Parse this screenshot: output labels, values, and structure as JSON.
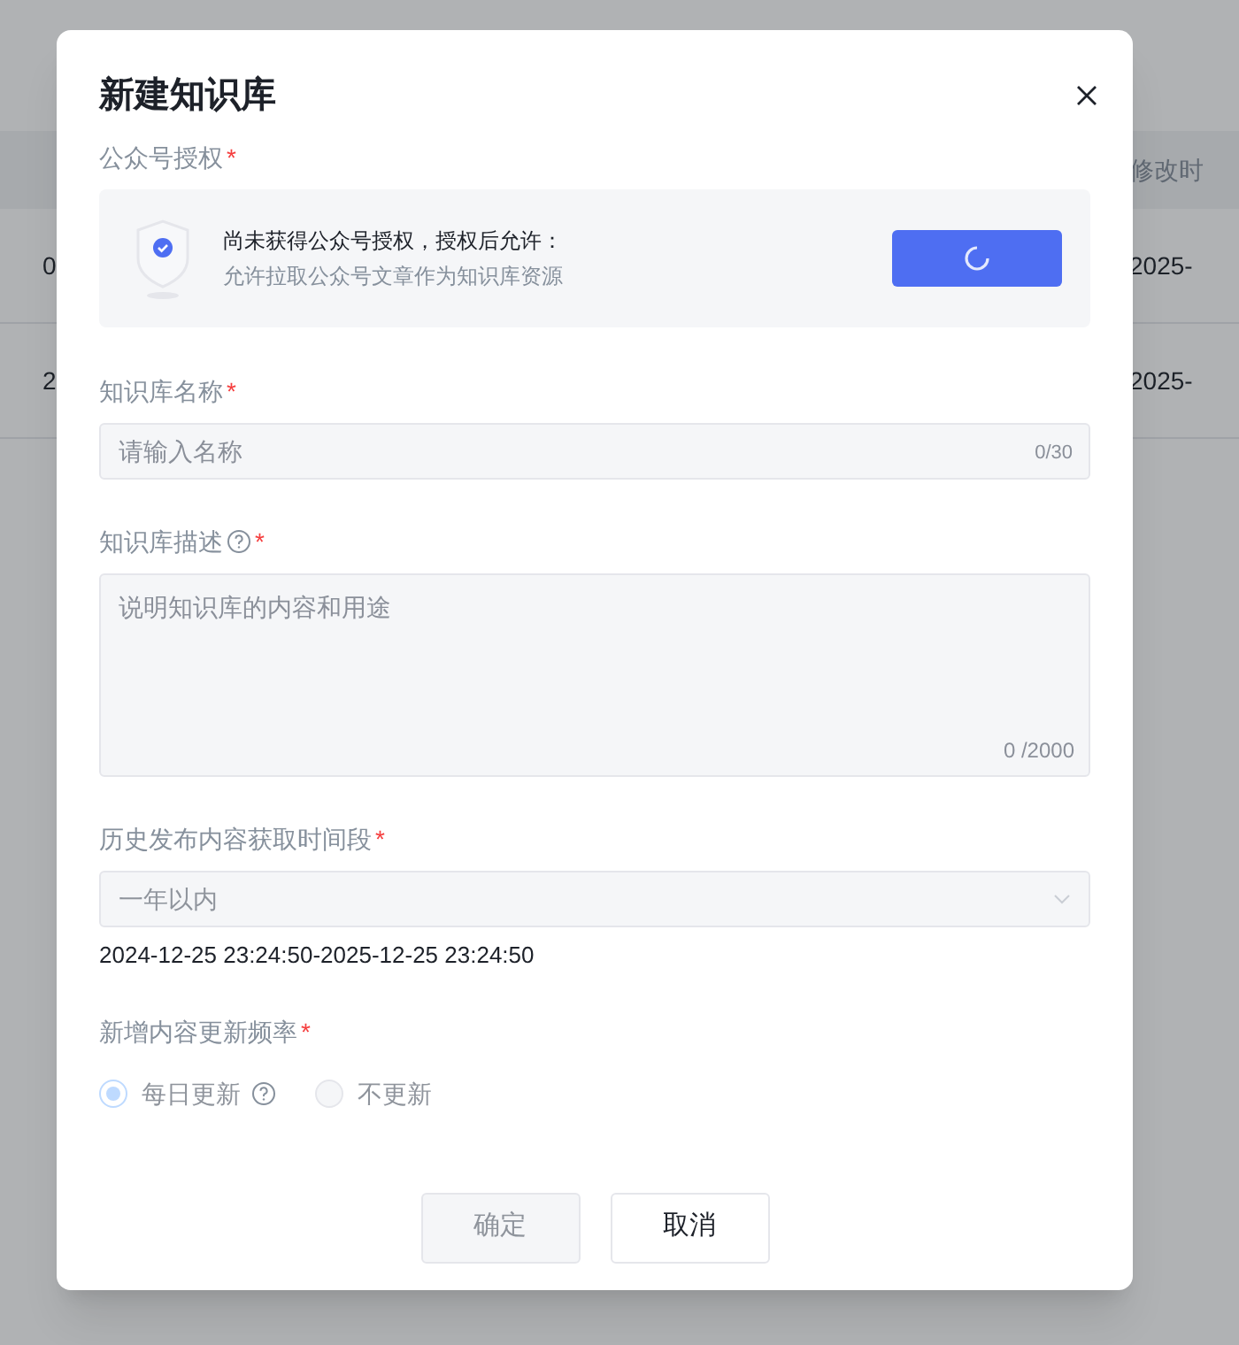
{
  "background": {
    "table": {
      "columns": [
        "",
        "修改时"
      ],
      "rows": [
        [
          "0",
          "2025-"
        ],
        [
          "2",
          "2025-"
        ]
      ]
    }
  },
  "dialog": {
    "title": "新建知识库",
    "auth": {
      "label": "公众号授权",
      "required_mark": "*",
      "notice": "尚未获得公众号授权，授权后允许：",
      "detail": "允许拉取公众号文章作为知识库资源",
      "button_loading": true
    },
    "name_field": {
      "label": "知识库名称",
      "required_mark": "*",
      "placeholder": "请输入名称",
      "counter": "0/30"
    },
    "description_field": {
      "label": "知识库描述",
      "help": true,
      "required_mark": "*",
      "placeholder": "说明知识库的内容和用途",
      "counter": "0 /2000"
    },
    "period_field": {
      "label": "历史发布内容获取时间段",
      "required_mark": "*",
      "value": "一年以内",
      "disabled": true,
      "range": "2024-12-25 23:24:50-2025-12-25 23:24:50"
    },
    "frequency_field": {
      "label": "新增内容更新频率",
      "required_mark": "*",
      "options": [
        {
          "label": "每日更新",
          "selected": true,
          "disabled": true,
          "help": true
        },
        {
          "label": "不更新",
          "selected": false,
          "disabled": true
        }
      ]
    },
    "buttons": [
      {
        "label": "确定",
        "kind": "primary",
        "disabled": true
      },
      {
        "label": "取消",
        "kind": "secondary",
        "disabled": false
      }
    ]
  }
}
